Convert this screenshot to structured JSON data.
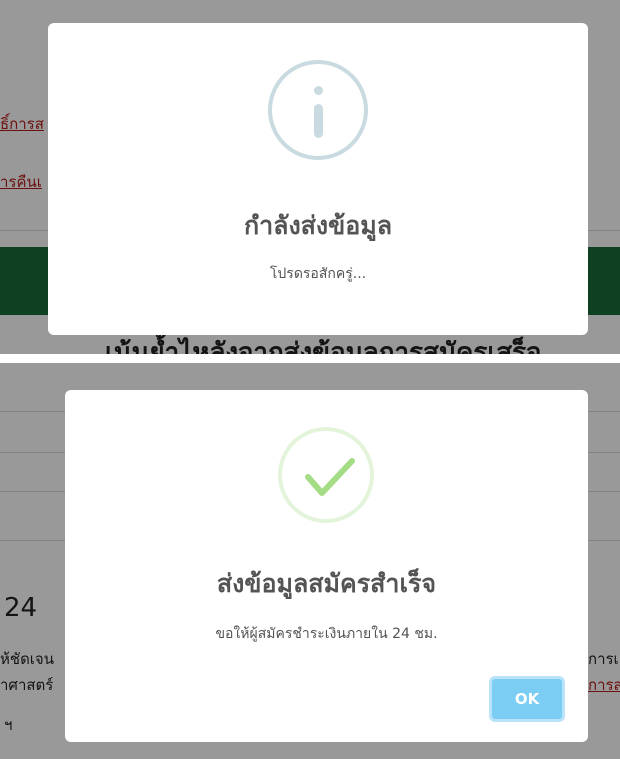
{
  "top_dialog": {
    "title": "กำลังส่งข้อมูล",
    "text": "โปรดรอสักครู่...",
    "icon": "info-icon"
  },
  "top_background": {
    "link1": "ธิ์การส",
    "link2": "ารคืนเ",
    "heading": "เน้นย้ำไหลังจากส่งข้อมูลการสมัครเสร็จ"
  },
  "bottom_dialog": {
    "title": "ส่งข้อมูลสมัครสำเร็จ",
    "text": "ขอให้ผู้สมัครชำระเงินภายใน 24 ชม.",
    "ok_label": "OK",
    "icon": "checkmark-icon"
  },
  "bottom_background": {
    "number": "24",
    "text_line1": "ห้ชัดเจน",
    "text_line2": "าศาสตร์",
    "right_text1": "การเ",
    "right_link": "การส",
    "footer_char": "ฯ"
  },
  "colors": {
    "overlay": "rgba(0,0,0,0.4)",
    "green_band": "#1b6b3a",
    "link": "#b71c1c",
    "ok_button": "#7ccdf4",
    "success_check": "#a5dc86",
    "info_icon": "#c9dae1"
  }
}
